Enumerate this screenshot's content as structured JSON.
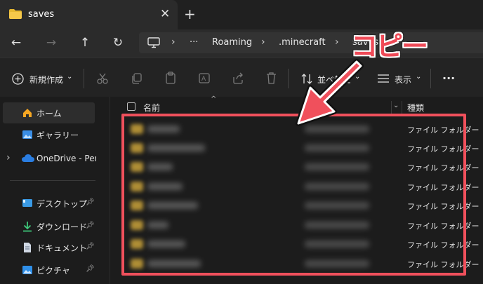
{
  "tab": {
    "title": "saves",
    "close": "✕",
    "new": "+"
  },
  "nav": {
    "back": "←",
    "forward": "→",
    "up": "↑",
    "refresh": "↻"
  },
  "address": {
    "more": "···",
    "crumbs": [
      "Roaming",
      ".minecraft",
      "saves"
    ],
    "sep": "›"
  },
  "toolbar": {
    "new_label": "新規作成",
    "sort_label": "並べ替え",
    "view_label": "表示",
    "more": "···"
  },
  "sidebar": {
    "home": "ホーム",
    "gallery": "ギャラリー",
    "onedrive": "OneDrive - Perso",
    "desktop": "デスクトップ",
    "downloads": "ダウンロード",
    "documents": "ドキュメント",
    "pictures": "ピクチャ",
    "expand": "›"
  },
  "columns": {
    "name": "名前",
    "type": "種類"
  },
  "rows": [
    {
      "type": "ファイル フォルダー"
    },
    {
      "type": "ファイル フォルダー"
    },
    {
      "type": "ファイル フォルダー"
    },
    {
      "type": "ファイル フォルダー"
    },
    {
      "type": "ファイル フォルダー"
    },
    {
      "type": "ファイル フォルダー"
    },
    {
      "type": "ファイル フォルダー"
    },
    {
      "type": "ファイル フォルダー"
    }
  ],
  "annotation": {
    "text": "コピー"
  },
  "colors": {
    "accent": "#f0505c",
    "folder": "#e8b931"
  }
}
